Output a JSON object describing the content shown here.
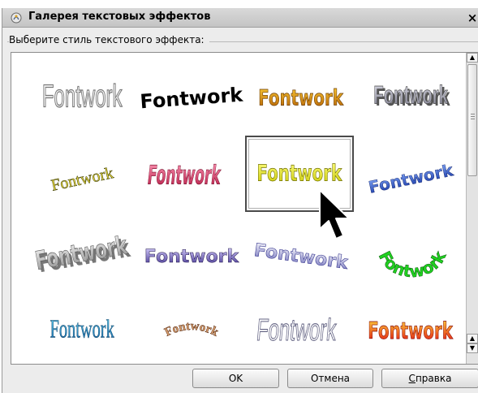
{
  "window": {
    "title": "Галерея текстовых эффектов",
    "close_glyph": "×"
  },
  "section_label": "Выберите стиль текстового эффекта:",
  "gallery": {
    "selected_index": 6,
    "items": [
      {
        "text": "Fontwork",
        "style": "outline-gray"
      },
      {
        "text": "Fontwork",
        "style": "bold-black-arc"
      },
      {
        "text": "Fontwork",
        "style": "orange-gradient"
      },
      {
        "text": "Fontwork",
        "style": "gray-3d"
      },
      {
        "text": "Fontwork",
        "style": "yellow-serif-slant"
      },
      {
        "text": "Fontwork",
        "style": "pink-perspective"
      },
      {
        "text": "Fontwork",
        "style": "yellow-gradient"
      },
      {
        "text": "Fontwork",
        "style": "blue-rising"
      },
      {
        "text": "Fontwork",
        "style": "gray-3d-arch"
      },
      {
        "text": "Fontwork",
        "style": "purple-3d"
      },
      {
        "text": "Fontwork",
        "style": "blue-wave"
      },
      {
        "text": "Fontwork",
        "style": "green-circle-arc"
      },
      {
        "text": "Fontwork",
        "style": "blue-plain"
      },
      {
        "text": "Fontwork",
        "style": "brown-arch"
      },
      {
        "text": "Fontwork",
        "style": "outline-wave"
      },
      {
        "text": "Fontwork",
        "style": "red-orange-bold"
      }
    ]
  },
  "scrollbar": {
    "position": 0.0
  },
  "buttons": {
    "ok": "OK",
    "cancel": "Отмена",
    "help_first": "С",
    "help_rest": "правка"
  },
  "colors": {
    "selection_border": "#4a4a4a",
    "window_bg": "#ececec"
  }
}
